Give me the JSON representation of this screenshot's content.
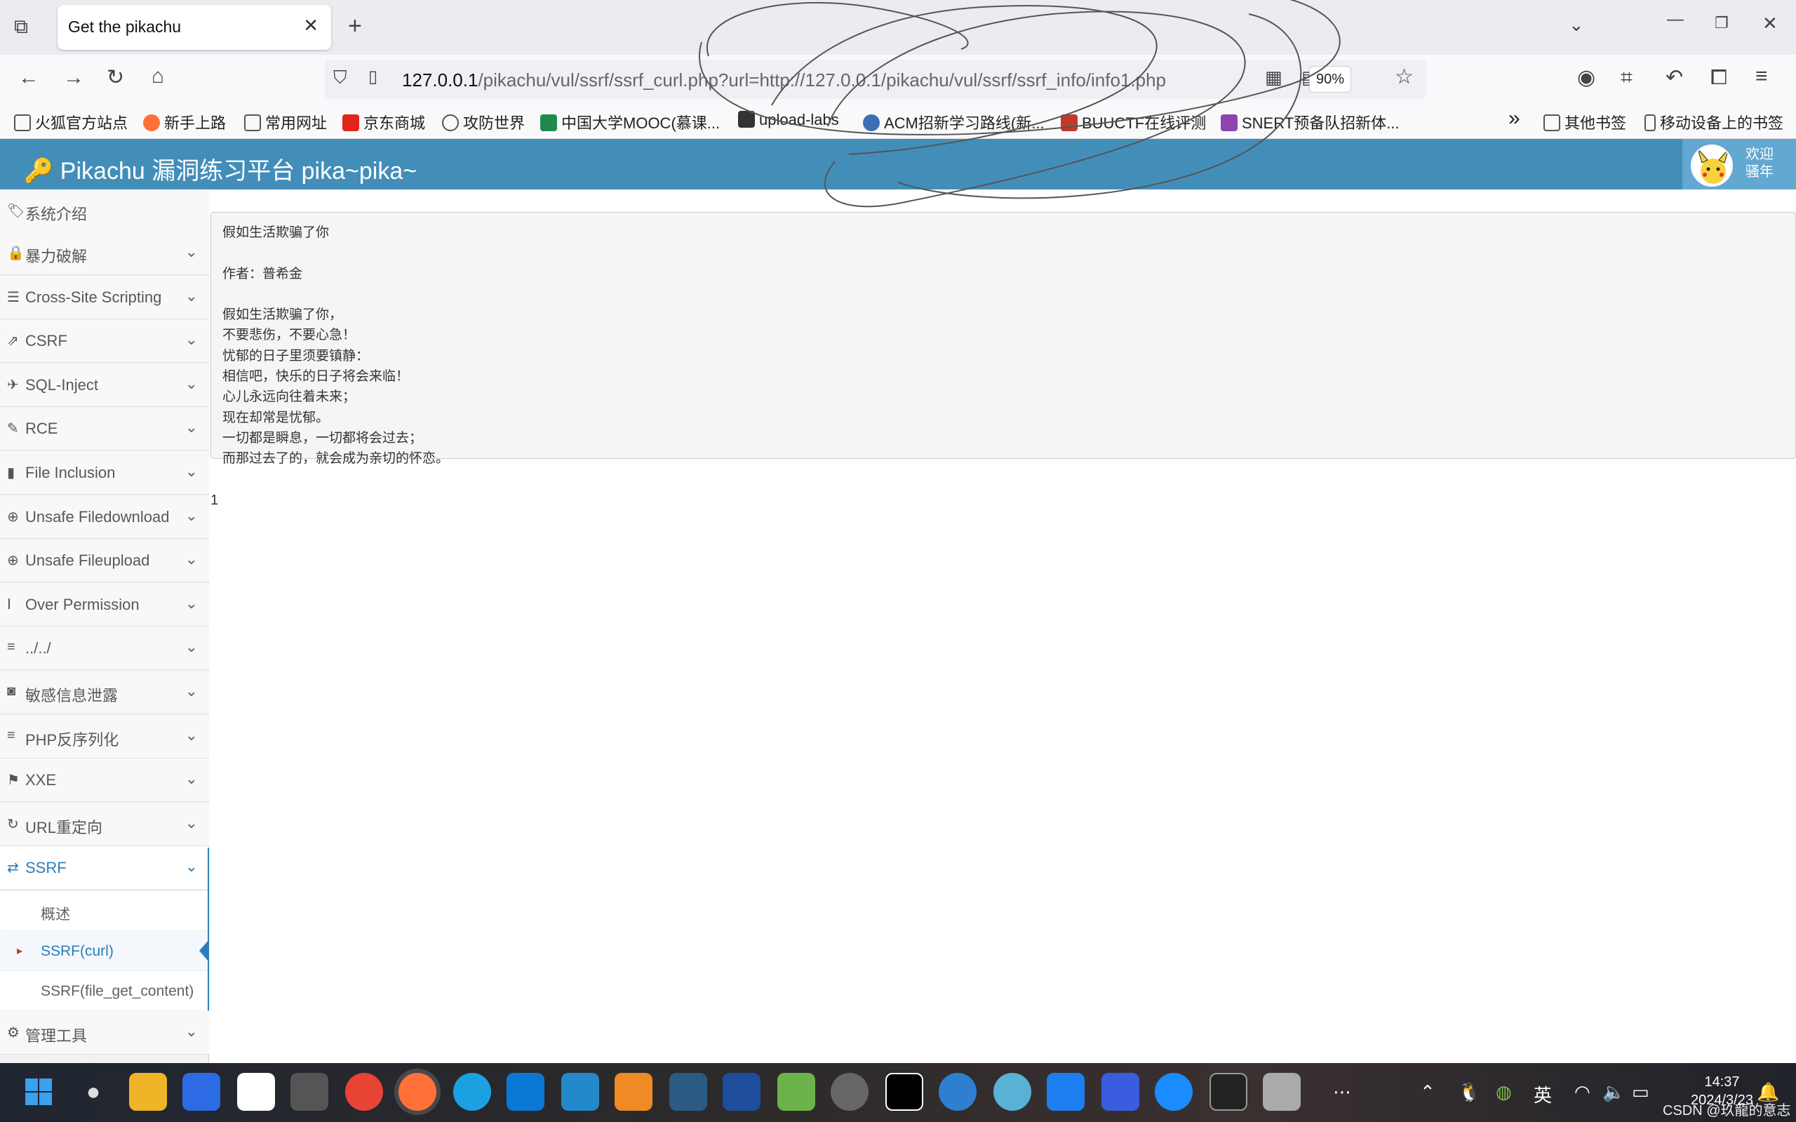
{
  "browser": {
    "tab_title": "Get the pikachu",
    "new_tab": "+",
    "url_host": "127.0.0.1",
    "url_path": "/pikachu/vul/ssrf/ssrf_curl.php?url=http://127.0.0.1/pikachu/vul/ssrf/ssrf_info/info1.php",
    "zoom": "90%",
    "bookmarks": [
      {
        "label": "火狐官方站点",
        "color": "#e66000"
      },
      {
        "label": "新手上路",
        "color": "#ff7139"
      },
      {
        "label": "常用网址",
        "color": "#777777"
      },
      {
        "label": "京东商城",
        "color": "#e1251b"
      },
      {
        "label": "攻防世界",
        "color": "#555555"
      },
      {
        "label": "中国大学MOOC(慕课...",
        "color": "#1f8a4c"
      },
      {
        "label": "upload-labs",
        "color": "#333333"
      },
      {
        "label": "ACM招新学习路线(新...",
        "color": "#3b6fb6"
      },
      {
        "label": "BUUCTF在线评测",
        "color": "#c0392b"
      },
      {
        "label": "SNERT预备队招新体...",
        "color": "#8e44ad"
      }
    ],
    "bookmarks_more": "»",
    "other_bookmarks": "其他书签",
    "mobile_bookmarks": "移动设备上的书签"
  },
  "app": {
    "title": "Pikachu 漏洞练习平台 pika~pika~",
    "welcome_line1": "欢迎",
    "welcome_line2": "骚年"
  },
  "sidebar": {
    "items": [
      {
        "label": "系统介绍",
        "icon": "tags-icon"
      },
      {
        "label": "暴力破解",
        "icon": "lock-icon"
      },
      {
        "label": "Cross-Site Scripting",
        "icon": "sliders-icon"
      },
      {
        "label": "CSRF",
        "icon": "share-icon"
      },
      {
        "label": "SQL-Inject",
        "icon": "fighter-jet-icon"
      },
      {
        "label": "RCE",
        "icon": "pencil-icon"
      },
      {
        "label": "File Inclusion",
        "icon": "file-icon"
      },
      {
        "label": "Unsafe Filedownload",
        "icon": "download-icon"
      },
      {
        "label": "Unsafe Fileupload",
        "icon": "upload-icon"
      },
      {
        "label": "Over Permission",
        "icon": "text-height-icon"
      },
      {
        "label": "../../",
        "icon": "align-left-icon"
      },
      {
        "label": "敏感信息泄露",
        "icon": "camera-icon"
      },
      {
        "label": "PHP反序列化",
        "icon": "align-justify-icon"
      },
      {
        "label": "XXE",
        "icon": "flag-icon"
      },
      {
        "label": "URL重定向",
        "icon": "refresh-icon"
      },
      {
        "label": "SSRF",
        "icon": "exchange-icon"
      }
    ],
    "ssrf_sub": [
      "概述",
      "SSRF(curl)",
      "SSRF(file_get_content)"
    ],
    "last_item": "管理工具"
  },
  "content": {
    "poem": "假如生活欺骗了你\n\n作者：普希金\n\n假如生活欺骗了你，\n不要悲伤，不要心急！\n忧郁的日子里须要镇静：\n相信吧，快乐的日子将会来临！\n心儿永远向往着未来；\n现在却常是忧郁。\n一切都是瞬息，一切都将会过去；\n而那过去了的，就会成为亲切的怀恋。",
    "result": "1"
  },
  "taskbar": {
    "time": "14:37",
    "date": "2024/3/23",
    "ime": "英",
    "watermark": "CSDN @玖龍的意志"
  },
  "colors": {
    "header": "#438eb9",
    "accent": "#2b7dbc"
  }
}
